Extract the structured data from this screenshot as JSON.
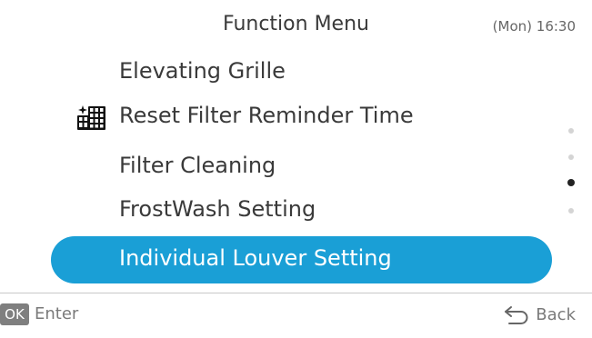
{
  "header": {
    "title": "Function Menu",
    "time": "(Mon) 16:30"
  },
  "menu": {
    "items": [
      {
        "label": "Elevating Grille",
        "icon": null
      },
      {
        "label": "Reset Filter Reminder Time",
        "icon": "filter-sparkle-icon"
      },
      {
        "label": "Filter Cleaning",
        "icon": null
      },
      {
        "label": "FrostWash Setting",
        "icon": null
      }
    ],
    "selected": {
      "label": "Individual Louver Setting"
    }
  },
  "pager": {
    "dot_count": 4,
    "active_index": 2
  },
  "footer": {
    "ok_badge": "OK",
    "enter_label": "Enter",
    "back_label": "Back",
    "back_icon": "return-arrow-icon"
  },
  "colors": {
    "selection": "#1a9fd6",
    "text": "#3a3a3a",
    "muted": "#7a7a7a"
  }
}
